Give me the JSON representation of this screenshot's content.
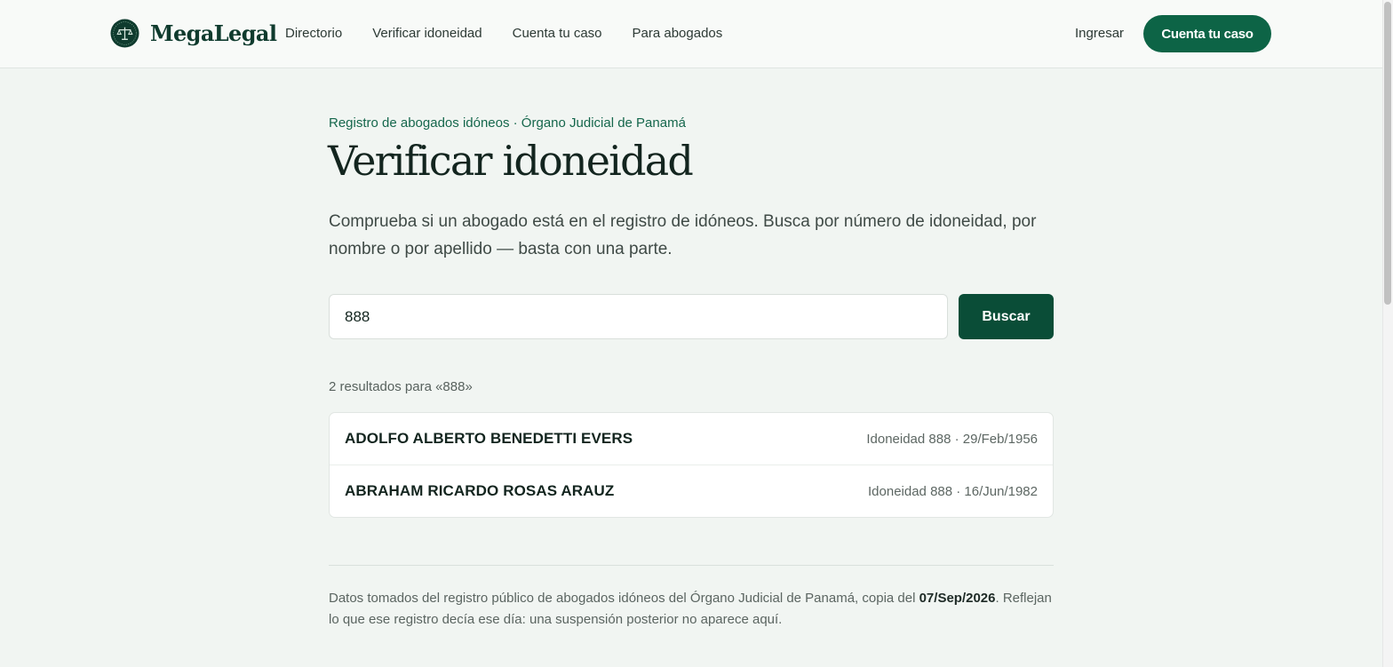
{
  "header": {
    "brand": "MegaLegal",
    "logo_icon": "scales-of-justice-icon",
    "nav": [
      {
        "label": "Directorio"
      },
      {
        "label": "Verificar idoneidad"
      },
      {
        "label": "Cuenta tu caso"
      },
      {
        "label": "Para abogados"
      }
    ],
    "login_label": "Ingresar",
    "cta_label": "Cuenta tu caso"
  },
  "main": {
    "eyebrow": "Registro de abogados idóneos · Órgano Judicial de Panamá",
    "title": "Verificar idoneidad",
    "intro": "Comprueba si un abogado está en el registro de idóneos. Busca por número de idoneidad, por nombre o por apellido — basta con una parte.",
    "search": {
      "value": "888",
      "button_label": "Buscar"
    },
    "results_count": "2 resultados para «888»",
    "results": [
      {
        "name": "ADOLFO ALBERTO BENEDETTI EVERS",
        "meta": "Idoneidad 888 · 29/Feb/1956"
      },
      {
        "name": "ABRAHAM RICARDO ROSAS ARAUZ",
        "meta": "Idoneidad 888 · 16/Jun/1982"
      }
    ],
    "footnote": {
      "before": "Datos tomados del registro público de abogados idóneos del Órgano Judicial de Panamá, copia del ",
      "date": "07/Sep/2026",
      "after": ". Reflejan lo que ese registro decía ese día: una suspensión posterior no aparece aquí."
    }
  },
  "colors": {
    "brand_green": "#0d6446",
    "dark_green": "#0a4d37",
    "page_background": "#f1f5f2"
  }
}
